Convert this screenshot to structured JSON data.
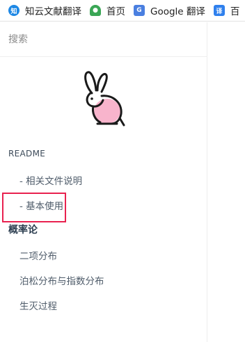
{
  "bookmarks": [
    {
      "label": "知云文献翻译",
      "icon": "zhiyun-icon",
      "glyph": "知"
    },
    {
      "label": "首页",
      "icon": "home-icon",
      "glyph": "🐾"
    },
    {
      "label": "Google 翻译",
      "icon": "google-translate-icon",
      "glyph": "G"
    },
    {
      "label": "百",
      "icon": "translate-icon",
      "glyph": "译"
    }
  ],
  "sidebar": {
    "search_placeholder": "搜索",
    "logo_icon": "rabbit-logo-icon",
    "section_title": "README",
    "items": [
      {
        "label": "- 相关文件说明"
      },
      {
        "label": "- 基本使用"
      },
      {
        "label": "概率论",
        "active": true
      },
      {
        "label": "二项分布"
      },
      {
        "label": "泊松分布与指数分布"
      },
      {
        "label": "生灭过程"
      }
    ]
  },
  "colors": {
    "highlight_border": "#e8214f",
    "rabbit_pink": "#f8b4cc",
    "text": "#34495e"
  }
}
